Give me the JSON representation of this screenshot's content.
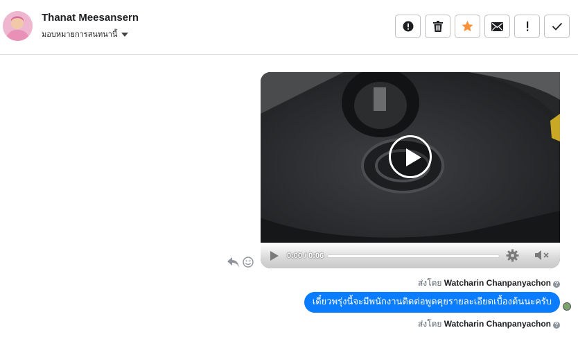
{
  "header": {
    "contact_name": "Thanat Meesansern",
    "assign_label": "มอบหมายการสนทนานี้",
    "toolbar": [
      {
        "name": "report-button",
        "icon": "alert-circle-icon"
      },
      {
        "name": "delete-button",
        "icon": "trash-icon"
      },
      {
        "name": "star-button",
        "icon": "star-icon"
      },
      {
        "name": "mark-unread-button",
        "icon": "envelope-icon"
      },
      {
        "name": "important-button",
        "icon": "exclamation-icon"
      },
      {
        "name": "done-button",
        "icon": "checkmark-icon"
      }
    ]
  },
  "video": {
    "time": "0:00 / 0:06",
    "progress": 0
  },
  "messages": {
    "sender_prefix_1": "ส่งโดย",
    "sender_name_1": "Watcharin Chanpanyachon",
    "bubble_text": "เดี๋ยวพรุ่งนี้จะมีพนักงานติดต่อพูดคุยรายละเอียดเบื้องต้นนะครับ",
    "sender_prefix_2": "ส่งโดย",
    "sender_name_2": "Watcharin Chanpanyachon",
    "help_glyph": "?"
  },
  "colors": {
    "bubble": "#0a7cff",
    "star": "#f7923a",
    "border": "#dddfe2"
  }
}
